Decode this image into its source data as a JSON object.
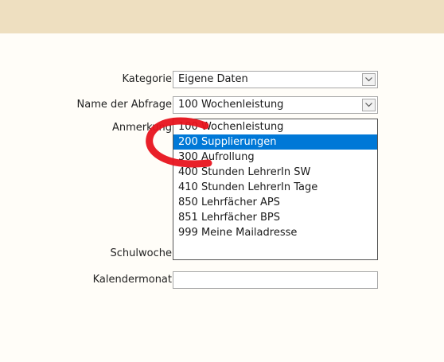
{
  "form": {
    "kategorie_label": "Kategorie",
    "kategorie_value": "Eigene Daten",
    "abfrage_label": "Name der Abfrage",
    "abfrage_value": "100 Wochenleistung",
    "anmerkung_label": "Anmerkung",
    "schulwoche_label": "Schulwoche",
    "kalendermonat_label": "Kalendermonat",
    "kalendermonat_value": ""
  },
  "dropdown": {
    "options": [
      "100 Wochenleistung",
      "200 Supplierungen",
      "300 Aufrollung",
      "400 Stunden LehrerIn SW",
      "410 Stunden LehrerIn Tage",
      "850 Lehrfächer APS",
      "851 Lehrfächer BPS",
      "999 Meine Mailadresse"
    ],
    "selected_index": 1
  },
  "colors": {
    "top_bar": "#eedfc0",
    "selection": "#0078d7",
    "annotation_marker": "#e8141e"
  },
  "icons": {
    "combo_button": "chevron-down-icon"
  }
}
